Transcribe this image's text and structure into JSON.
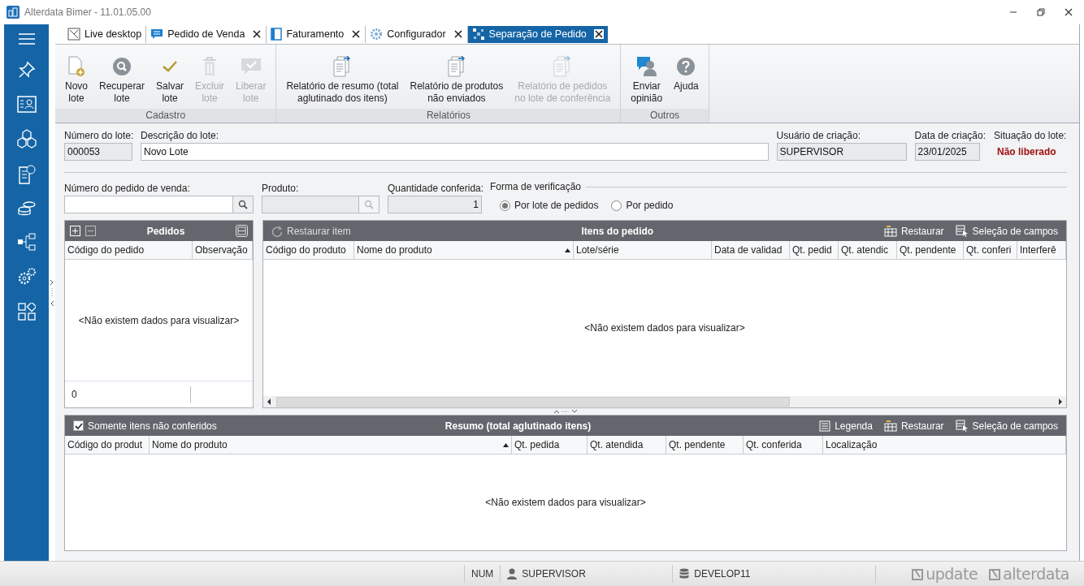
{
  "window": {
    "title": "Alterdata Bimer - 11.01.05.00"
  },
  "tabs": [
    {
      "label": "Live desktop",
      "closable": false,
      "selected": false
    },
    {
      "label": "Pedido de Venda",
      "closable": true,
      "selected": false
    },
    {
      "label": "Faturamento",
      "closable": true,
      "selected": false
    },
    {
      "label": "Configurador",
      "closable": true,
      "selected": false
    },
    {
      "label": "Separação de Pedido",
      "closable": true,
      "selected": true
    }
  ],
  "ribbon": {
    "groups": [
      {
        "label": "Cadastro",
        "buttons": [
          {
            "label": "Novo\nlote",
            "disabled": false
          },
          {
            "label": "Recuperar\nlote",
            "disabled": false
          },
          {
            "label": "Salvar\nlote",
            "disabled": false
          },
          {
            "label": "Excluir\nlote",
            "disabled": true
          },
          {
            "label": "Liberar\nlote",
            "disabled": true
          }
        ]
      },
      {
        "label": "Relatórios",
        "buttons": [
          {
            "label": "Relatório de resumo (total\naglutinado dos itens)",
            "disabled": false
          },
          {
            "label": "Relatório de produtos\nnão enviados",
            "disabled": false
          },
          {
            "label": "Relatório de pedidos\nno lote de conferência",
            "disabled": true
          }
        ]
      },
      {
        "label": "Outros",
        "buttons": [
          {
            "label": "Enviar\nopinião",
            "disabled": false
          },
          {
            "label": "Ajuda",
            "disabled": false
          }
        ]
      }
    ]
  },
  "header_fields": [
    {
      "label": "Número do lote:",
      "value": "000053",
      "kind": "readonly"
    },
    {
      "label": "Descrição do lote:",
      "value": "Novo Lote",
      "kind": "input"
    },
    {
      "label": "Usuário de criação:",
      "value": "SUPERVISOR",
      "kind": "readonly"
    },
    {
      "label": "Data de criação:",
      "value": "23/01/2025",
      "kind": "readonly"
    },
    {
      "label": "Situação do lote:",
      "value": "Não liberado",
      "kind": "status"
    }
  ],
  "filter_fields": [
    {
      "label": "Número do pedido de venda:",
      "kind": "search",
      "disabled": false
    },
    {
      "label": "Produto:",
      "kind": "search",
      "disabled": true
    },
    {
      "label": "Quantidade conferida:",
      "value": "1",
      "kind": "number",
      "disabled": true
    }
  ],
  "verification": {
    "legend": "Forma de verificação",
    "options": [
      {
        "label": "Por lote de pedidos",
        "selected": true
      },
      {
        "label": "Por pedido",
        "selected": false
      }
    ]
  },
  "pedidos": {
    "title": "Pedidos",
    "columns": [
      {
        "label": "Código do pedido",
        "sorted": false
      },
      {
        "label": "Observação",
        "sorted": false
      }
    ],
    "empty_text": "<Não existem dados para visualizar>",
    "footer": "0"
  },
  "itens": {
    "title": "Itens do pedido",
    "restore_item": "Restaurar item",
    "actions": [
      "Restaurar",
      "Seleção de campos"
    ],
    "columns": [
      {
        "label": "Código do produto",
        "sorted": false
      },
      {
        "label": "Nome do produto",
        "sorted": true
      },
      {
        "label": "Lote/série",
        "sorted": false
      },
      {
        "label": "Data de validad",
        "sorted": false
      },
      {
        "label": "Qt. pedid",
        "sorted": false
      },
      {
        "label": "Qt. atendic",
        "sorted": false
      },
      {
        "label": "Qt. pendente",
        "sorted": false
      },
      {
        "label": "Qt. conferi",
        "sorted": false
      },
      {
        "label": "Interferê",
        "sorted": false
      }
    ],
    "empty_text": "<Não existem dados para visualizar>"
  },
  "resumo": {
    "title": "Resumo (total aglutinado itens)",
    "filter": {
      "label": "Somente itens não conferidos",
      "checked": true
    },
    "actions": [
      "Legenda",
      "Restaurar",
      "Seleção de campos"
    ],
    "columns": [
      {
        "label": "Código do produt",
        "sorted": false
      },
      {
        "label": "Nome do produto",
        "sorted": true
      },
      {
        "label": "Qt. pedida",
        "sorted": false
      },
      {
        "label": "Qt. atendida",
        "sorted": false
      },
      {
        "label": "Qt. pendente",
        "sorted": false
      },
      {
        "label": "Qt. conferida",
        "sorted": false
      },
      {
        "label": "Localização",
        "sorted": false
      }
    ],
    "empty_text": "<Não existem dados para visualizar>"
  },
  "status_bar": {
    "num": "NUM",
    "user": "SUPERVISOR",
    "database": "DEVELOP11",
    "logos": [
      "update",
      "alterdata"
    ]
  }
}
